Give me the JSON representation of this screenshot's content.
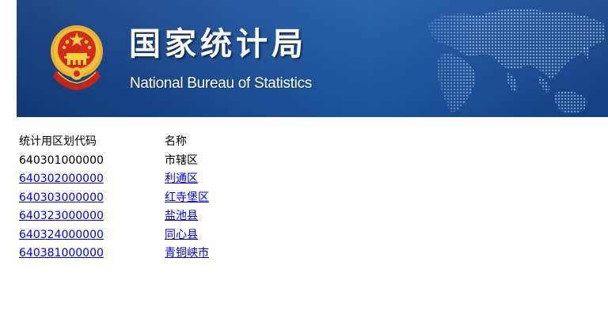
{
  "header": {
    "title_zh": "国家统计局",
    "title_en": "National Bureau of Statistics",
    "emblem_icon": "national-emblem-icon",
    "map_icon": "world-map-icon",
    "colors": {
      "banner_primary": "#1a4f98",
      "banner_dark": "#123b7e",
      "emblem_red": "#d42a1d",
      "emblem_gold": "#f3c13a"
    }
  },
  "table": {
    "headers": {
      "code": "统计用区划代码",
      "name": "名称"
    },
    "rows": [
      {
        "code": "640301000000",
        "name": "市辖区",
        "link": false
      },
      {
        "code": "640302000000",
        "name": "利通区",
        "link": true
      },
      {
        "code": "640303000000",
        "name": "红寺堡区",
        "link": true
      },
      {
        "code": "640323000000",
        "name": "盐池县",
        "link": true
      },
      {
        "code": "640324000000",
        "name": "同心县",
        "link": true
      },
      {
        "code": "640381000000",
        "name": "青铜峡市",
        "link": true
      }
    ],
    "link_color": "#0000ee"
  }
}
